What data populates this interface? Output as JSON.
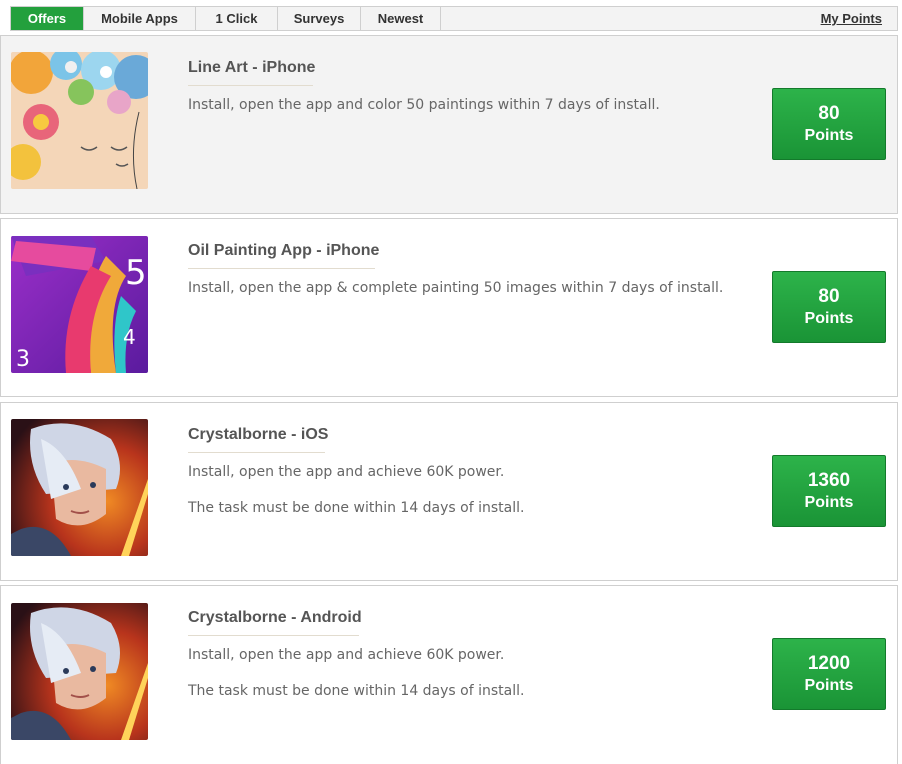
{
  "tabs": [
    {
      "label": "Offers",
      "active": true
    },
    {
      "label": "Mobile Apps",
      "active": false
    },
    {
      "label": "1 Click",
      "active": false
    },
    {
      "label": "Surveys",
      "active": false
    },
    {
      "label": "Newest",
      "active": false
    }
  ],
  "my_points_label": "My Points",
  "offers": [
    {
      "title": "Line Art - iPhone",
      "description": [
        "Install, open the app and color 50 paintings within 7 days of install."
      ],
      "points": "80",
      "points_unit": "Points"
    },
    {
      "title": "Oil Painting App - iPhone",
      "description": [
        "Install, open the app & complete painting 50 images within 7 days of install."
      ],
      "points": "80",
      "points_unit": "Points"
    },
    {
      "title": "Crystalborne - iOS",
      "description": [
        "Install, open the app and achieve 60K power.",
        "The task must be done within 14 days of install."
      ],
      "points": "1360",
      "points_unit": "Points"
    },
    {
      "title": "Crystalborne - Android",
      "description": [
        "Install, open the app and achieve 60K power.",
        "The task must be done within 14 days of install."
      ],
      "points": "1200",
      "points_unit": "Points"
    }
  ],
  "thumbnail_digits": [
    "5",
    "4",
    "3"
  ],
  "colors": {
    "accent_green": "#23a03d",
    "button_green": "#1fa33f"
  },
  "icons": [
    "line-art-app-icon",
    "oil-painting-app-icon",
    "crystalborne-ios-icon",
    "crystalborne-android-icon"
  ]
}
